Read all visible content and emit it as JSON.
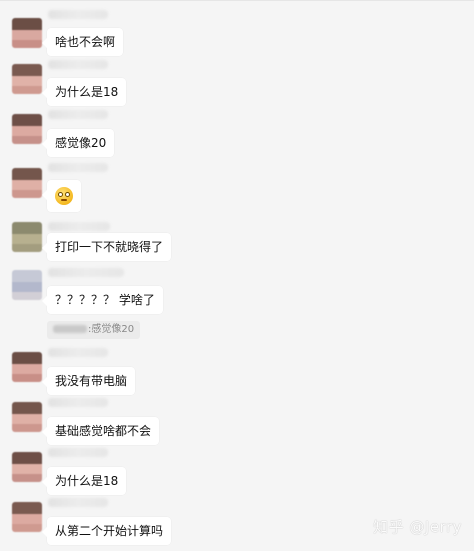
{
  "messages": [
    {
      "text": "啥也不会啊"
    },
    {
      "text": "为什么是18"
    },
    {
      "text": "感觉像20"
    },
    {
      "text": "",
      "icon": "grimace-emoji-icon"
    },
    {
      "text": "打印一下不就晓得了"
    },
    {
      "text": "？？？？？ 学啥了"
    },
    {
      "text": "我没有带电脑"
    },
    {
      "text": "基础感觉啥都不会"
    },
    {
      "text": "为什么是18"
    },
    {
      "text": "从第二个开始计算吗"
    }
  ],
  "quote": {
    "text": ":感觉像20"
  },
  "watermark": {
    "text": "知乎 @Jerry"
  },
  "colors": {
    "background": "#f5f5f5",
    "bubble": "#ffffff",
    "quote_bg": "#ebebeb"
  }
}
